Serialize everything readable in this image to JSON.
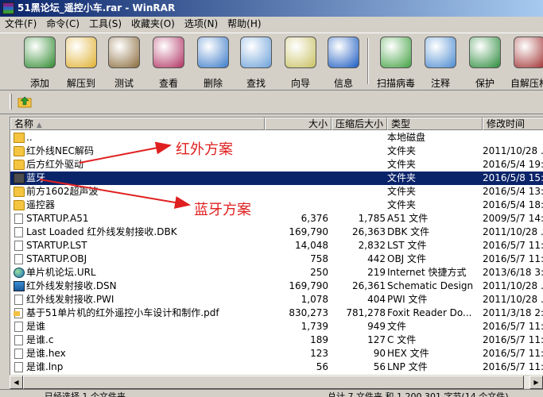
{
  "window": {
    "title": "51黑论坛_遥控小车.rar - WinRAR"
  },
  "menu": [
    "文件(F)",
    "命令(C)",
    "工具(S)",
    "收藏夹(O)",
    "选项(N)",
    "帮助(H)"
  ],
  "toolbar": [
    {
      "label": "添加",
      "icon": "add-archive-icon",
      "color": "#2f8a2f"
    },
    {
      "label": "解压到",
      "icon": "extract-folder-icon",
      "color": "#e0b030"
    },
    {
      "label": "测试",
      "icon": "test-clipboard-icon",
      "color": "#8a6a3a"
    },
    {
      "label": "查看",
      "icon": "view-books-icon",
      "color": "#b03060"
    },
    {
      "label": "删除",
      "icon": "delete-bin-icon",
      "color": "#3a7ac8"
    },
    {
      "label": "查找",
      "icon": "magnifier-icon",
      "color": "#6aa0d8"
    },
    {
      "label": "向导",
      "icon": "wizard-wand-icon",
      "color": "#c8c060"
    },
    {
      "label": "信息",
      "icon": "info-icon",
      "color": "#1a5ac0"
    },
    {
      "label": "扫描病毒",
      "icon": "virus-scan-doctor-icon",
      "color": "#40a040"
    },
    {
      "label": "注释",
      "icon": "comment-pen-icon",
      "color": "#4a8ad0"
    },
    {
      "label": "保护",
      "icon": "protect-lock-icon",
      "color": "#2a8a3a"
    },
    {
      "label": "自解压格",
      "icon": "sfx-books-icon",
      "color": "#a03030"
    }
  ],
  "columns": [
    "名称",
    "大小",
    "压缩后大小",
    "类型",
    "修改时间"
  ],
  "files": [
    {
      "icon": "parent",
      "name": "..",
      "size": "",
      "packed": "",
      "type": "本地磁盘",
      "modified": ""
    },
    {
      "icon": "folder",
      "name": "红外线NEC解码",
      "size": "",
      "packed": "",
      "type": "文件夹",
      "modified": "2011/10/28 ."
    },
    {
      "icon": "folder",
      "name": "后方红外驱动",
      "size": "",
      "packed": "",
      "type": "文件夹",
      "modified": "2016/5/4 19:2"
    },
    {
      "icon": "folder-dark",
      "name": "蓝牙",
      "size": "",
      "packed": "",
      "type": "文件夹",
      "modified": "2016/5/8 15:3",
      "selected": true
    },
    {
      "icon": "folder",
      "name": "前方1602超声波",
      "size": "",
      "packed": "",
      "type": "文件夹",
      "modified": "2016/5/4 13:5"
    },
    {
      "icon": "folder",
      "name": "遥控器",
      "size": "",
      "packed": "",
      "type": "文件夹",
      "modified": "2016/5/4 18:2"
    },
    {
      "icon": "doc",
      "name": "STARTUP.A51",
      "size": "6,376",
      "packed": "1,785",
      "type": "A51 文件",
      "modified": "2009/5/7 14:3"
    },
    {
      "icon": "doc",
      "name": "Last Loaded 红外线发射接收.DBK",
      "size": "169,790",
      "packed": "26,363",
      "type": "DBK 文件",
      "modified": "2011/10/28 ."
    },
    {
      "icon": "doc",
      "name": "STARTUP.LST",
      "size": "14,048",
      "packed": "2,832",
      "type": "LST 文件",
      "modified": "2016/5/7 11:1"
    },
    {
      "icon": "doc",
      "name": "STARTUP.OBJ",
      "size": "758",
      "packed": "442",
      "type": "OBJ 文件",
      "modified": "2016/5/7 11:1"
    },
    {
      "icon": "globe",
      "name": "单片机论坛.URL",
      "size": "250",
      "packed": "219",
      "type": "Internet 快捷方式",
      "modified": "2013/6/18 3:2"
    },
    {
      "icon": "exe",
      "name": "红外线发射接收.DSN",
      "size": "169,790",
      "packed": "26,361",
      "type": "Schematic Design",
      "modified": "2011/10/28 ."
    },
    {
      "icon": "doc",
      "name": "红外线发射接收.PWI",
      "size": "1,078",
      "packed": "404",
      "type": "PWI 文件",
      "modified": "2011/10/28 ."
    },
    {
      "icon": "pdf",
      "name": "基于51单片机的红外遥控小车设计和制作.pdf",
      "size": "830,273",
      "packed": "781,278",
      "type": "Foxit Reader Do...",
      "modified": "2011/3/18 2:"
    },
    {
      "icon": "doc",
      "name": "是谁",
      "size": "1,739",
      "packed": "949",
      "type": "文件",
      "modified": "2016/5/7 11:1"
    },
    {
      "icon": "doc",
      "name": "是谁.c",
      "size": "189",
      "packed": "127",
      "type": "C 文件",
      "modified": "2016/5/7 11:1"
    },
    {
      "icon": "doc",
      "name": "是谁.hex",
      "size": "123",
      "packed": "90",
      "type": "HEX 文件",
      "modified": "2016/5/7 11:1"
    },
    {
      "icon": "doc",
      "name": "是谁.lnp",
      "size": "56",
      "packed": "56",
      "type": "LNP 文件",
      "modified": "2016/5/7 11:1"
    }
  ],
  "annotations": {
    "infrared": "红外方案",
    "bluetooth": "蓝牙方案",
    "color": "#e02020"
  },
  "status": {
    "left": "已经选择 1 个文件夹",
    "right": "总计 7 文件夹 和 1,200,301 字节(14 个文件)"
  }
}
